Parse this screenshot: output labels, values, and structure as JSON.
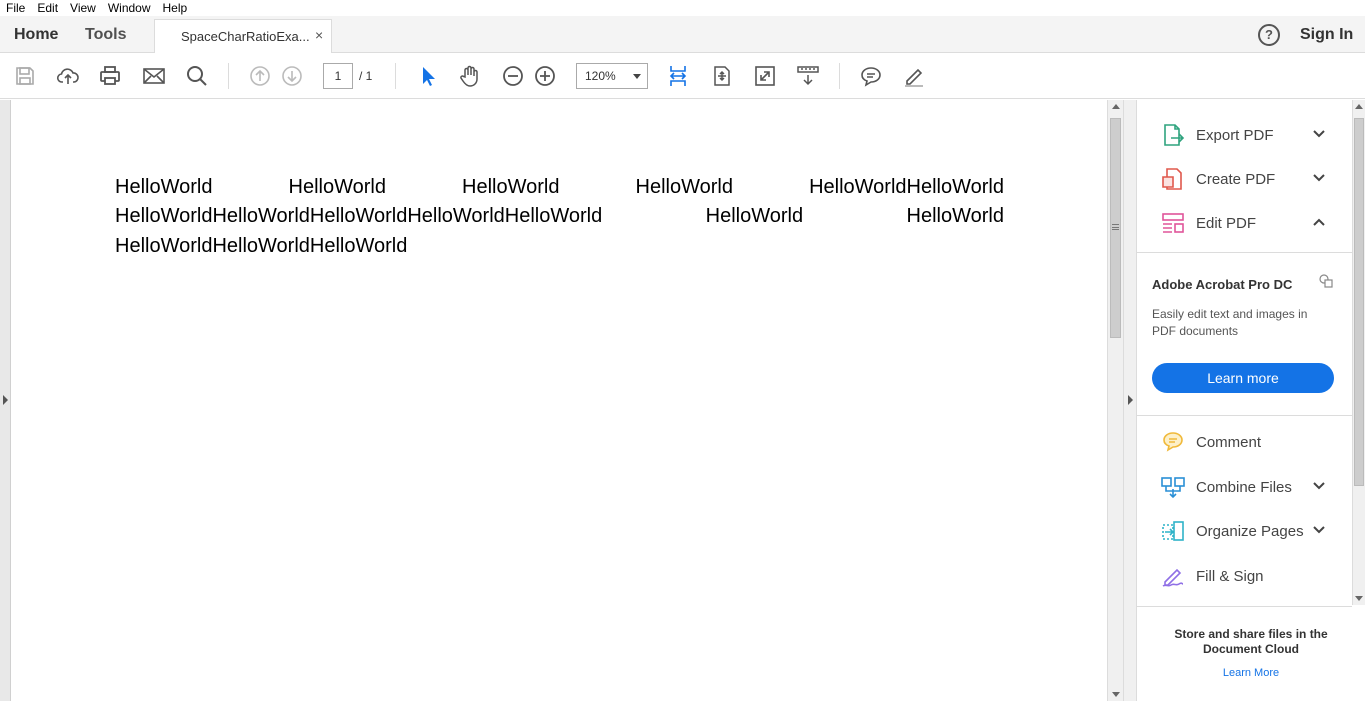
{
  "menu": [
    "File",
    "Edit",
    "View",
    "Window",
    "Help"
  ],
  "tabs": {
    "home": "Home",
    "tools": "Tools",
    "document": "SpaceCharRatioExa...",
    "close": "×"
  },
  "header": {
    "help": "?",
    "sign_in": "Sign In"
  },
  "toolbar": {
    "page_current": "1",
    "page_total": "/ 1",
    "zoom": "120%"
  },
  "document": {
    "lines": [
      [
        "HelloWorld",
        "HelloWorld",
        "HelloWorld",
        "HelloWorld",
        "HelloWorldHelloWorld"
      ],
      [
        "HelloWorldHelloWorldHelloWorldHelloWorldHelloWorld",
        "HelloWorld",
        "HelloWorld"
      ],
      [
        "HelloWorldHelloWorldHelloWorld"
      ]
    ]
  },
  "right_pane": {
    "items_top": [
      {
        "label": "Export PDF",
        "icon": "export-pdf-icon",
        "chevron": "down"
      },
      {
        "label": "Create PDF",
        "icon": "create-pdf-icon",
        "chevron": "down"
      },
      {
        "label": "Edit PDF",
        "icon": "edit-pdf-icon",
        "chevron": "up"
      }
    ],
    "promo": {
      "title": "Adobe Acrobat Pro DC",
      "description": "Easily edit text and images in PDF documents",
      "button": "Learn more"
    },
    "items_bottom": [
      {
        "label": "Comment",
        "icon": "comment-icon",
        "chevron": ""
      },
      {
        "label": "Combine Files",
        "icon": "combine-files-icon",
        "chevron": "down"
      },
      {
        "label": "Organize Pages",
        "icon": "organize-pages-icon",
        "chevron": "down"
      },
      {
        "label": "Fill & Sign",
        "icon": "fill-sign-icon",
        "chevron": ""
      }
    ],
    "cloud": {
      "text": "Store and share files in the Document Cloud",
      "link": "Learn More"
    }
  },
  "colors": {
    "accent": "#1473e6",
    "export_icon": "#2fa37e",
    "create_icon": "#e0584c",
    "edit_icon": "#e0559a",
    "comment_icon": "#f0b93a",
    "combine_icon": "#2a8fd6",
    "organize_icon": "#2fb3c8",
    "fillsign_icon": "#8f6fe6"
  }
}
